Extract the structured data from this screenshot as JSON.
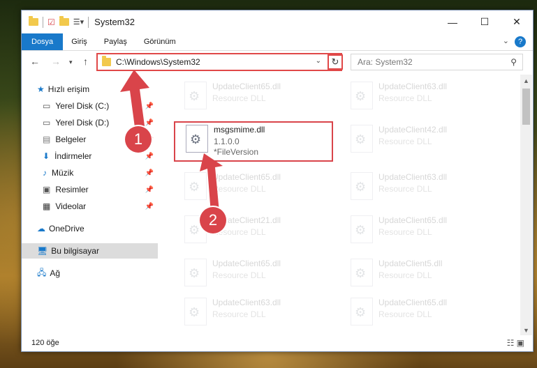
{
  "window": {
    "title": "System32",
    "controls": {
      "minimize": "—",
      "maximize": "☐",
      "close": "✕"
    }
  },
  "ribbon": {
    "tabs": [
      "Dosya",
      "Giriş",
      "Paylaş",
      "Görünüm"
    ],
    "help": "?"
  },
  "nav": {
    "address": "C:\\Windows\\System32",
    "search_placeholder": "Ara: System32"
  },
  "sidebar": {
    "items": [
      {
        "label": "Hızlı erişim",
        "icon": "star-icon"
      },
      {
        "label": "Yerel Disk (C:)",
        "icon": "drive-icon",
        "pinned": true
      },
      {
        "label": "Yerel Disk (D:)",
        "icon": "drive-icon",
        "pinned": true
      },
      {
        "label": "Belgeler",
        "icon": "documents-icon",
        "pinned": true
      },
      {
        "label": "İndirmeler",
        "icon": "downloads-icon",
        "pinned": true
      },
      {
        "label": "Müzik",
        "icon": "music-icon",
        "pinned": true
      },
      {
        "label": "Resimler",
        "icon": "pictures-icon",
        "pinned": true
      },
      {
        "label": "Videolar",
        "icon": "videos-icon",
        "pinned": true
      },
      {
        "label": "OneDrive",
        "icon": "cloud-icon"
      },
      {
        "label": "Bu bilgisayar",
        "icon": "computer-icon",
        "selected": true
      },
      {
        "label": "Ağ",
        "icon": "network-icon"
      }
    ]
  },
  "files": {
    "highlighted": {
      "name": "msgsmime.dll",
      "version": "1.1.0.0",
      "description": "*FileVersion"
    },
    "faded": [
      {
        "name": "UpdateClient65.dll",
        "sub": "Resource DLL"
      },
      {
        "name": "UpdateClient63.dll",
        "sub": "Resource DLL"
      },
      {
        "name": "UpdateClient42.dll",
        "sub": "Resource DLL"
      },
      {
        "name": "UpdateClient65.dll",
        "sub": "Resource DLL"
      },
      {
        "name": "UpdateClient63.dll",
        "sub": "Resource DLL"
      },
      {
        "name": "UpdateClient21.dll",
        "sub": "Resource DLL"
      },
      {
        "name": "UpdateClient65.dll",
        "sub": "Resource DLL"
      },
      {
        "name": "UpdateClient65.dll",
        "sub": "Resource DLL"
      },
      {
        "name": "UpdateClient5.dll",
        "sub": "Resource DLL"
      },
      {
        "name": "UpdateClient63.dll",
        "sub": "Resource DLL"
      },
      {
        "name": "UpdateClient65.dll",
        "sub": "Resource DLL"
      }
    ]
  },
  "status": {
    "count": "120 öğe"
  },
  "callouts": [
    "1",
    "2"
  ],
  "colors": {
    "accent": "#1979ca",
    "annotation": "#d9444a",
    "selected": "#dcdcdc"
  }
}
